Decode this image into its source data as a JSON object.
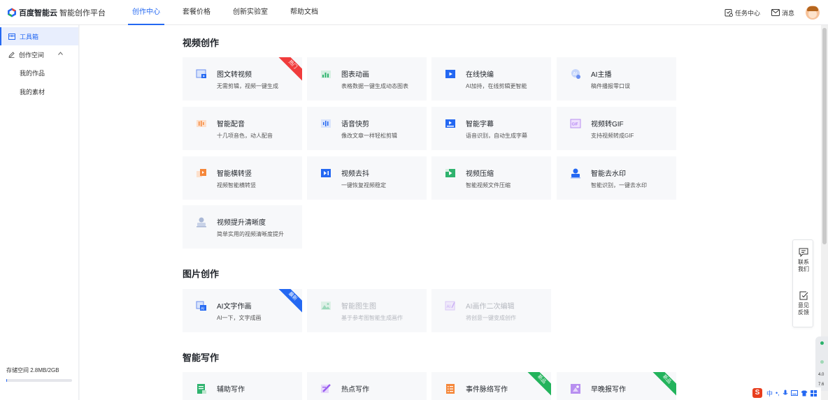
{
  "header": {
    "brand": "百度智能云",
    "subtitle": "智能创作平台",
    "nav": [
      {
        "label": "创作中心",
        "active": true
      },
      {
        "label": "套餐价格",
        "active": false
      },
      {
        "label": "创新实验室",
        "active": false
      },
      {
        "label": "帮助文档",
        "active": false
      }
    ],
    "task_center": "任务中心",
    "messages": "消息"
  },
  "sidebar": {
    "toolbox": "工具箱",
    "workspace": "创作空间",
    "my_works": "我的作品",
    "my_materials": "我的素材",
    "storage_text": "存储空间 2.8MB/2GB",
    "storage_used_fraction": 0.0014
  },
  "sections": {
    "video": {
      "title": "视频创作",
      "cards": [
        {
          "title": "图文转视频",
          "desc": "无需剪辑，视频一键生成",
          "badge": "热门",
          "icon": "image-to-video-icon"
        },
        {
          "title": "图表动画",
          "desc": "表格数据一键生成动态图表",
          "icon": "chart-animation-icon"
        },
        {
          "title": "在线快编",
          "desc": "AI加持，在线剪辑更智能",
          "icon": "online-edit-icon"
        },
        {
          "title": "AI主播",
          "desc": "稿件播报零口误",
          "icon": "ai-anchor-icon"
        },
        {
          "title": "智能配音",
          "desc": "十几项音色，动人配音",
          "icon": "dubbing-icon"
        },
        {
          "title": "语音快剪",
          "desc": "像改文章一样轻松剪辑",
          "icon": "voice-cut-icon"
        },
        {
          "title": "智能字幕",
          "desc": "语音识别，自动生成字幕",
          "icon": "subtitle-icon"
        },
        {
          "title": "视频转GIF",
          "desc": "支持视频转成GIF",
          "icon": "gif-icon"
        },
        {
          "title": "智能横转竖",
          "desc": "视频智能横转竖",
          "icon": "landscape-to-portrait-icon"
        },
        {
          "title": "视频去抖",
          "desc": "一键恢复视频稳定",
          "icon": "stabilize-icon"
        },
        {
          "title": "视频压缩",
          "desc": "智能视频文件压缩",
          "icon": "compress-icon"
        },
        {
          "title": "智能去水印",
          "desc": "智能识别，一键去水印",
          "icon": "watermark-remove-icon"
        },
        {
          "title": "视频提升清晰度",
          "desc": "简单实用的视频清晰度提升",
          "icon": "enhance-icon"
        }
      ]
    },
    "image": {
      "title": "图片创作",
      "cards": [
        {
          "title": "AI文字作画",
          "desc": "AI一下，文字成画",
          "badge": "最新",
          "icon": "ai-paint-icon"
        },
        {
          "title": "智能图生图",
          "desc": "基于参考图智能生成画作",
          "icon": "image-to-image-icon"
        },
        {
          "title": "AI画作二次编辑",
          "desc": "将创意一键变成创作",
          "icon": "ai-edit-icon"
        }
      ]
    },
    "writing": {
      "title": "智能写作",
      "cards": [
        {
          "title": "辅助写作",
          "icon": "assist-writing-icon"
        },
        {
          "title": "热点写作",
          "icon": "hot-writing-icon"
        },
        {
          "title": "事件脉络写作",
          "badge": "新品",
          "icon": "event-writing-icon"
        },
        {
          "title": "早晚报写作",
          "badge": "新品",
          "icon": "report-writing-icon"
        }
      ]
    }
  },
  "float_panel": {
    "contact": "联系我们",
    "feedback": "意见反馈"
  },
  "ime": {
    "logo": "S",
    "mode": "中"
  },
  "side_widget": {
    "line1": "4.0",
    "line2": "7.6"
  },
  "colors": {
    "accent": "#2468f2",
    "hot_badge": "#f03c3c",
    "new_badge_blue": "#2468f2",
    "new_badge_green": "#23b35c"
  }
}
